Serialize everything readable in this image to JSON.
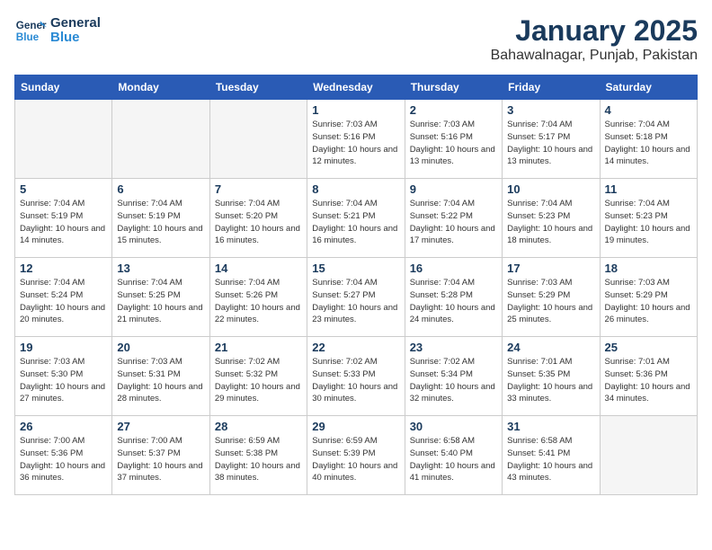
{
  "header": {
    "logo_line1": "General",
    "logo_line2": "Blue",
    "title": "January 2025",
    "subtitle": "Bahawalnagar, Punjab, Pakistan"
  },
  "days_of_week": [
    "Sunday",
    "Monday",
    "Tuesday",
    "Wednesday",
    "Thursday",
    "Friday",
    "Saturday"
  ],
  "weeks": [
    [
      {
        "day": "",
        "empty": true
      },
      {
        "day": "",
        "empty": true
      },
      {
        "day": "",
        "empty": true
      },
      {
        "day": "1",
        "sunrise": "7:03 AM",
        "sunset": "5:16 PM",
        "daylight": "10 hours and 12 minutes."
      },
      {
        "day": "2",
        "sunrise": "7:03 AM",
        "sunset": "5:16 PM",
        "daylight": "10 hours and 13 minutes."
      },
      {
        "day": "3",
        "sunrise": "7:04 AM",
        "sunset": "5:17 PM",
        "daylight": "10 hours and 13 minutes."
      },
      {
        "day": "4",
        "sunrise": "7:04 AM",
        "sunset": "5:18 PM",
        "daylight": "10 hours and 14 minutes."
      }
    ],
    [
      {
        "day": "5",
        "sunrise": "7:04 AM",
        "sunset": "5:19 PM",
        "daylight": "10 hours and 14 minutes."
      },
      {
        "day": "6",
        "sunrise": "7:04 AM",
        "sunset": "5:19 PM",
        "daylight": "10 hours and 15 minutes."
      },
      {
        "day": "7",
        "sunrise": "7:04 AM",
        "sunset": "5:20 PM",
        "daylight": "10 hours and 16 minutes."
      },
      {
        "day": "8",
        "sunrise": "7:04 AM",
        "sunset": "5:21 PM",
        "daylight": "10 hours and 16 minutes."
      },
      {
        "day": "9",
        "sunrise": "7:04 AM",
        "sunset": "5:22 PM",
        "daylight": "10 hours and 17 minutes."
      },
      {
        "day": "10",
        "sunrise": "7:04 AM",
        "sunset": "5:23 PM",
        "daylight": "10 hours and 18 minutes."
      },
      {
        "day": "11",
        "sunrise": "7:04 AM",
        "sunset": "5:23 PM",
        "daylight": "10 hours and 19 minutes."
      }
    ],
    [
      {
        "day": "12",
        "sunrise": "7:04 AM",
        "sunset": "5:24 PM",
        "daylight": "10 hours and 20 minutes."
      },
      {
        "day": "13",
        "sunrise": "7:04 AM",
        "sunset": "5:25 PM",
        "daylight": "10 hours and 21 minutes."
      },
      {
        "day": "14",
        "sunrise": "7:04 AM",
        "sunset": "5:26 PM",
        "daylight": "10 hours and 22 minutes."
      },
      {
        "day": "15",
        "sunrise": "7:04 AM",
        "sunset": "5:27 PM",
        "daylight": "10 hours and 23 minutes."
      },
      {
        "day": "16",
        "sunrise": "7:04 AM",
        "sunset": "5:28 PM",
        "daylight": "10 hours and 24 minutes."
      },
      {
        "day": "17",
        "sunrise": "7:03 AM",
        "sunset": "5:29 PM",
        "daylight": "10 hours and 25 minutes."
      },
      {
        "day": "18",
        "sunrise": "7:03 AM",
        "sunset": "5:29 PM",
        "daylight": "10 hours and 26 minutes."
      }
    ],
    [
      {
        "day": "19",
        "sunrise": "7:03 AM",
        "sunset": "5:30 PM",
        "daylight": "10 hours and 27 minutes."
      },
      {
        "day": "20",
        "sunrise": "7:03 AM",
        "sunset": "5:31 PM",
        "daylight": "10 hours and 28 minutes."
      },
      {
        "day": "21",
        "sunrise": "7:02 AM",
        "sunset": "5:32 PM",
        "daylight": "10 hours and 29 minutes."
      },
      {
        "day": "22",
        "sunrise": "7:02 AM",
        "sunset": "5:33 PM",
        "daylight": "10 hours and 30 minutes."
      },
      {
        "day": "23",
        "sunrise": "7:02 AM",
        "sunset": "5:34 PM",
        "daylight": "10 hours and 32 minutes."
      },
      {
        "day": "24",
        "sunrise": "7:01 AM",
        "sunset": "5:35 PM",
        "daylight": "10 hours and 33 minutes."
      },
      {
        "day": "25",
        "sunrise": "7:01 AM",
        "sunset": "5:36 PM",
        "daylight": "10 hours and 34 minutes."
      }
    ],
    [
      {
        "day": "26",
        "sunrise": "7:00 AM",
        "sunset": "5:36 PM",
        "daylight": "10 hours and 36 minutes."
      },
      {
        "day": "27",
        "sunrise": "7:00 AM",
        "sunset": "5:37 PM",
        "daylight": "10 hours and 37 minutes."
      },
      {
        "day": "28",
        "sunrise": "6:59 AM",
        "sunset": "5:38 PM",
        "daylight": "10 hours and 38 minutes."
      },
      {
        "day": "29",
        "sunrise": "6:59 AM",
        "sunset": "5:39 PM",
        "daylight": "10 hours and 40 minutes."
      },
      {
        "day": "30",
        "sunrise": "6:58 AM",
        "sunset": "5:40 PM",
        "daylight": "10 hours and 41 minutes."
      },
      {
        "day": "31",
        "sunrise": "6:58 AM",
        "sunset": "5:41 PM",
        "daylight": "10 hours and 43 minutes."
      },
      {
        "day": "",
        "empty": true
      }
    ]
  ]
}
